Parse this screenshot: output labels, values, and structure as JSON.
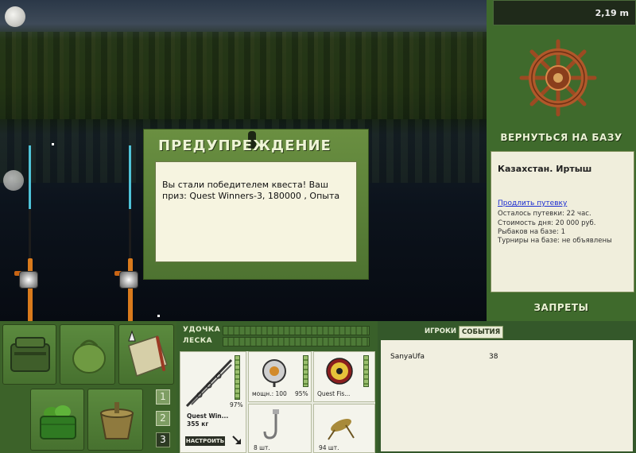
{
  "scene": {
    "depth": "2,19 m"
  },
  "warning": {
    "title": "ПРЕДУПРЕЖДЕНИЕ",
    "message": "Вы стали победителем квеста! Ваш приз: Quest Winners-3, 180000 , Опыта"
  },
  "right_panel": {
    "return_label": "ВЕРНУТЬСЯ НА БАЗУ",
    "location": "Казахстан. Иртыш",
    "extend_link": "Продлить путевку",
    "info_lines": [
      "Осталось путевки: 22 час.",
      "Стоимость дня: 20 000 руб.",
      "Рыбаков на базе: 1",
      "Турниры на базе: не объявлены"
    ],
    "bans_label": "ЗАПРЕТЫ"
  },
  "inventory": {
    "pages": [
      "1",
      "2",
      "3"
    ],
    "active_page": "3"
  },
  "tackle": {
    "rod_label": "УДОЧКА",
    "line_label": "ЛЕСКА",
    "rod_percent": "97%",
    "rod_name": "Quest Win...",
    "rod_weight": "355 кг",
    "tune_label": "НАСТРОИТЬ",
    "reel_power": "мощн.: 100",
    "reel_percent": "95%",
    "line_name": "Quest Fis...",
    "hook_count": "8 шт.",
    "bait_count": "94 шт."
  },
  "players": {
    "tabs": [
      "ИГРОКИ",
      "СОБЫТИЯ"
    ],
    "active_tab": "СОБЫТИЯ",
    "rows": [
      {
        "name": "SanyaUfa",
        "value": "38"
      }
    ]
  },
  "colors": {
    "panel_green": "#3f6a2c",
    "dialog_paper": "#f6f4e0",
    "link_blue": "#1a2cd2"
  }
}
